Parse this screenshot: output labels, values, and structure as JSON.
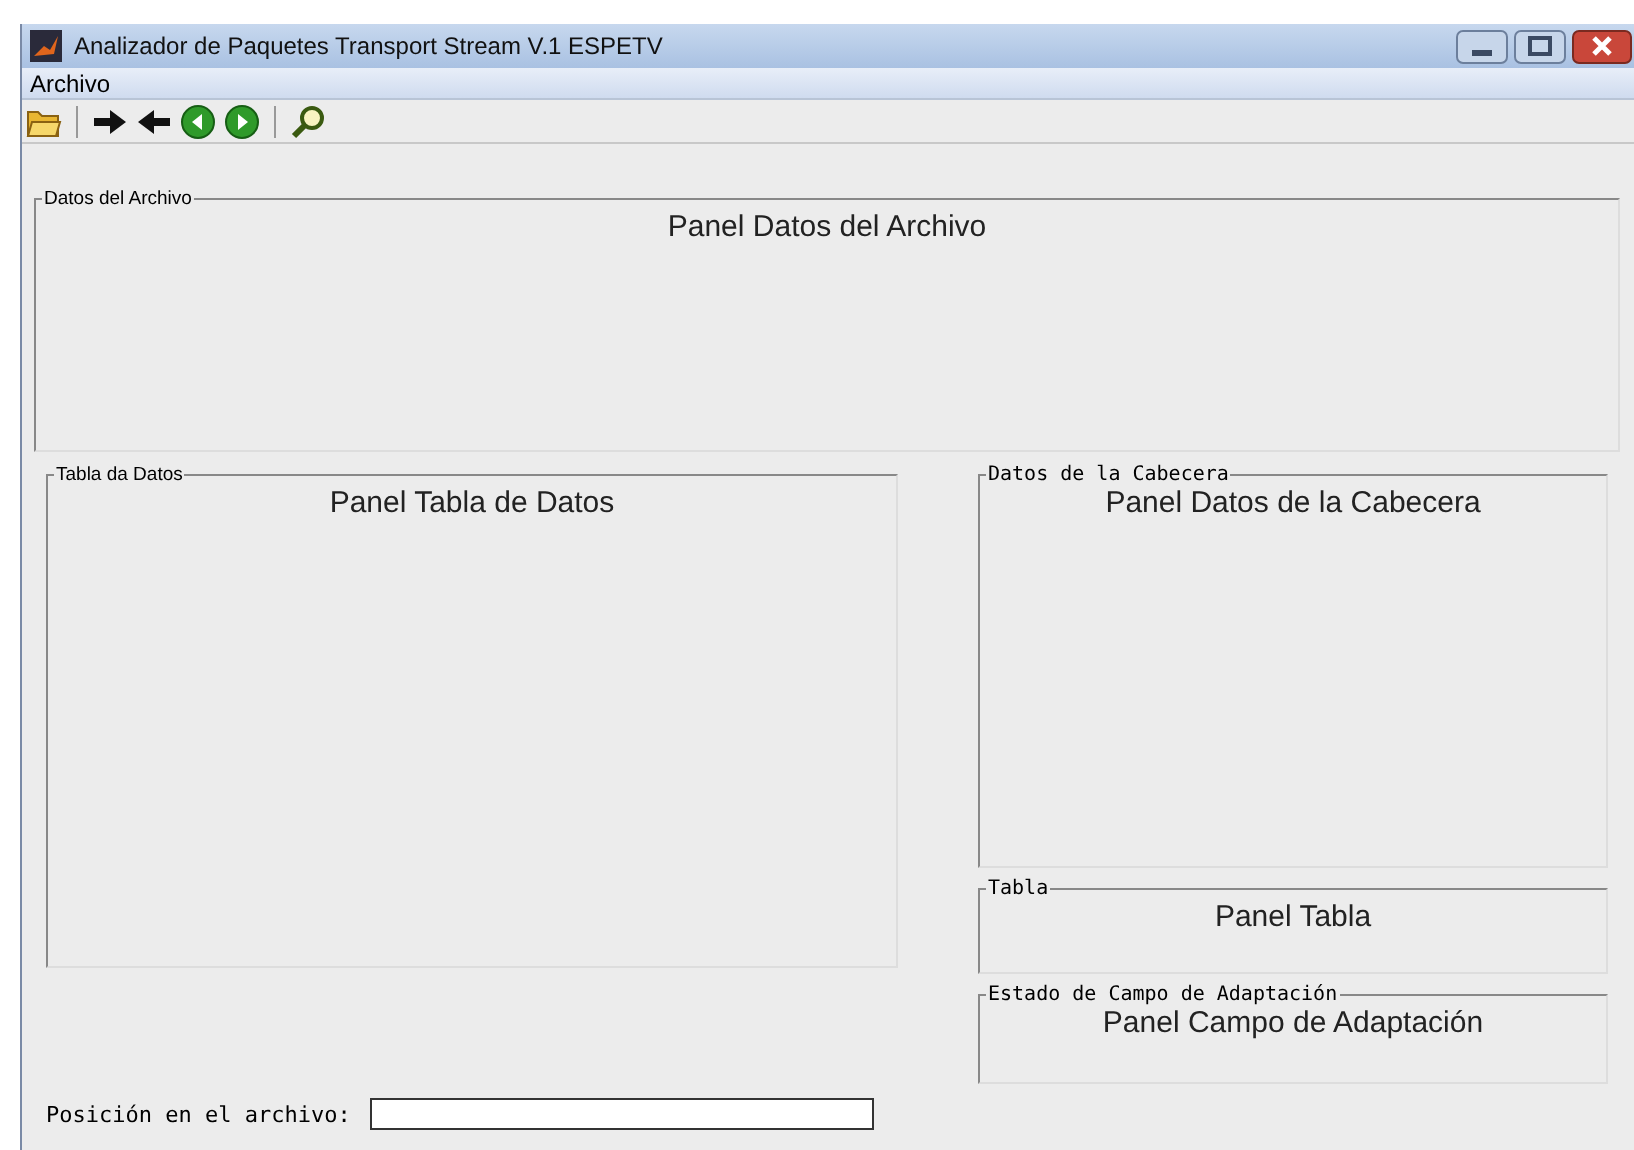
{
  "window": {
    "title": "Analizador de Paquetes Transport Stream V.1  ESPETV"
  },
  "menu": [
    "Archivo"
  ],
  "panels": [
    {
      "legend": "Datos del Archivo",
      "content": "Panel Datos del Archivo"
    },
    {
      "legend": "Tabla da Datos",
      "content": "Panel Tabla de Datos"
    },
    {
      "legend": "Datos de la Cabecera",
      "content": "Panel Datos de la Cabecera"
    },
    {
      "legend": "Tabla",
      "content": "Panel Tabla"
    },
    {
      "legend": "Estado de Campo de Adaptación",
      "content": "Panel Campo de Adaptación"
    }
  ],
  "position": {
    "label": "Posición en el archivo:"
  }
}
